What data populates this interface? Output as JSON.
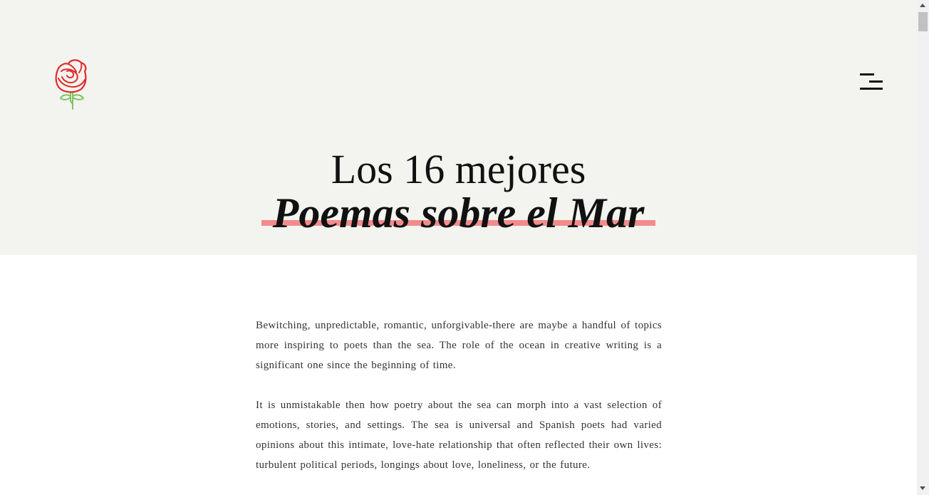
{
  "header": {
    "logo_icon": "rose-icon",
    "menu_icon": "hamburger-menu-icon",
    "background_color": "#f3f3ef"
  },
  "title": {
    "line1": "Los 16 mejores",
    "line2": "Poemas sobre el Mar",
    "underline_color": "#f38b8b"
  },
  "article": {
    "paragraphs": [
      "Bewitching, unpredictable, romantic, unforgivable-there are maybe a handful of topics more inspiring to poets than the sea. The role of the ocean in creative writing is a significant one since the beginning of time.",
      "It is unmistakable then how poetry about the sea can morph into a vast selection of emotions, stories, and settings. The sea is universal and Spanish poets had varied opinions about this intimate, love-hate relationship that often reflected their own lives: turbulent political periods, longings about love, loneliness, or the future."
    ]
  },
  "scrollbar": {
    "up_icon": "scroll-up-arrow-icon",
    "down_icon": "scroll-down-arrow-icon"
  }
}
